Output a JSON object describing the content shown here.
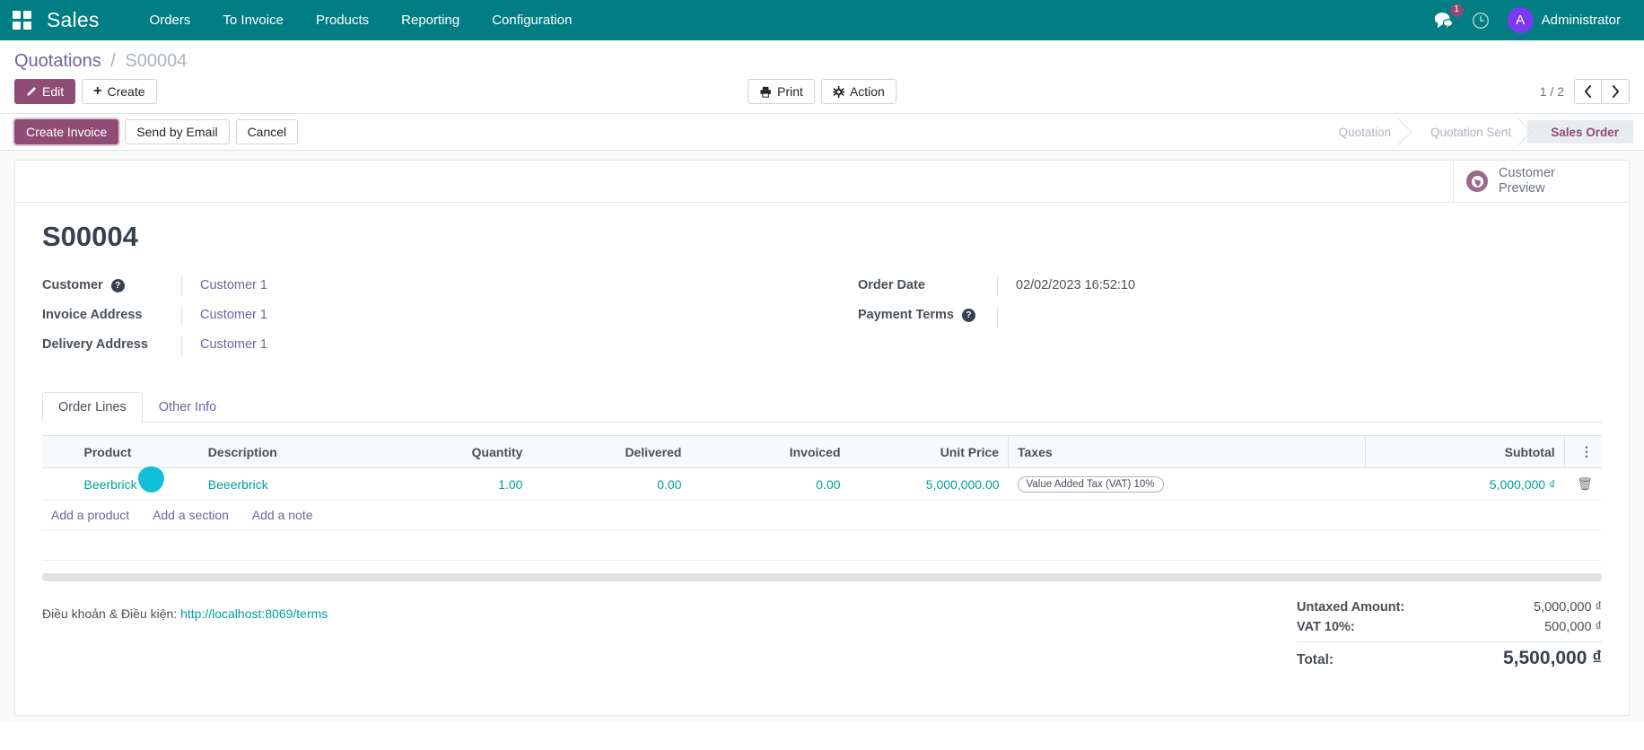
{
  "navbar": {
    "apps_icon": "apps-grid-icon",
    "brand": "Sales",
    "menu": [
      {
        "label": "Orders"
      },
      {
        "label": "To Invoice"
      },
      {
        "label": "Products"
      },
      {
        "label": "Reporting"
      },
      {
        "label": "Configuration"
      }
    ],
    "messages_icon": "chat-bubble-icon",
    "messages_count": "1",
    "activities_icon": "clock-icon",
    "avatar_initial": "A",
    "user_name": "Administrator",
    "bg_color": "#017e84"
  },
  "breadcrumb": {
    "root": "Quotations",
    "separator": "/",
    "current": "S00004"
  },
  "control_panel": {
    "edit_label": "Edit",
    "edit_icon": "pencil-icon",
    "create_label": "Create",
    "create_icon": "plus-icon",
    "print_label": "Print",
    "print_icon": "printer-icon",
    "action_label": "Action",
    "action_icon": "gear-icon",
    "pager_value": "1 / 2",
    "prev_icon": "chevron-left-icon",
    "next_icon": "chevron-right-icon"
  },
  "status_row": {
    "buttons": [
      {
        "label": "Create Invoice",
        "highlight": true
      },
      {
        "label": "Send by Email",
        "highlight": false
      },
      {
        "label": "Cancel",
        "highlight": false
      }
    ],
    "stages": [
      {
        "label": "Quotation",
        "active": false
      },
      {
        "label": "Quotation Sent",
        "active": false
      },
      {
        "label": "Sales Order",
        "active": true
      }
    ],
    "active_color": "#8f4c74"
  },
  "sheet": {
    "customer_preview_icon": "globe-icon",
    "customer_preview_label_line1": "Customer",
    "customer_preview_label_line2": "Preview",
    "record_title": "S00004",
    "fields_left": [
      {
        "label": "Customer",
        "value": "Customer 1",
        "help": true,
        "link": true
      },
      {
        "label": "Invoice Address",
        "value": "Customer 1",
        "help": false,
        "link": true
      },
      {
        "label": "Delivery Address",
        "value": "Customer 1",
        "help": false,
        "link": true
      }
    ],
    "fields_right": [
      {
        "label": "Order Date",
        "value": "02/02/2023 16:52:10",
        "help": false,
        "link": false
      },
      {
        "label": "Payment Terms",
        "value": "",
        "help": true,
        "link": false
      }
    ]
  },
  "notebook": {
    "tabs": [
      {
        "label": "Order Lines",
        "active": true
      },
      {
        "label": "Other Info",
        "active": false
      }
    ]
  },
  "order_lines": {
    "columns": [
      "Product",
      "Description",
      "Quantity",
      "Delivered",
      "Invoiced",
      "Unit Price",
      "Taxes",
      "Subtotal"
    ],
    "options_icon": "vertical-dots-icon",
    "rows": [
      {
        "product": "Beerbrick",
        "description": "Beeerbrick",
        "quantity": "1.00",
        "delivered": "0.00",
        "invoiced": "0.00",
        "unit_price": "5,000,000.00",
        "tax": "Value Added Tax (VAT) 10%",
        "subtotal": "5,000,000 ₫",
        "delete_icon": "trash-icon"
      }
    ],
    "add_links": [
      {
        "label": "Add a product"
      },
      {
        "label": "Add a section"
      },
      {
        "label": "Add a note"
      }
    ]
  },
  "footer": {
    "terms_label": "Điều khoản & Điều kiện:",
    "terms_link": "http://localhost:8069/terms",
    "totals": [
      {
        "label": "Untaxed Amount:",
        "value": "5,000,000 ₫"
      },
      {
        "label": "VAT 10%:",
        "value": "500,000 ₫"
      }
    ],
    "grand_total_label": "Total:",
    "grand_total_value": "5,500,000 ₫"
  }
}
